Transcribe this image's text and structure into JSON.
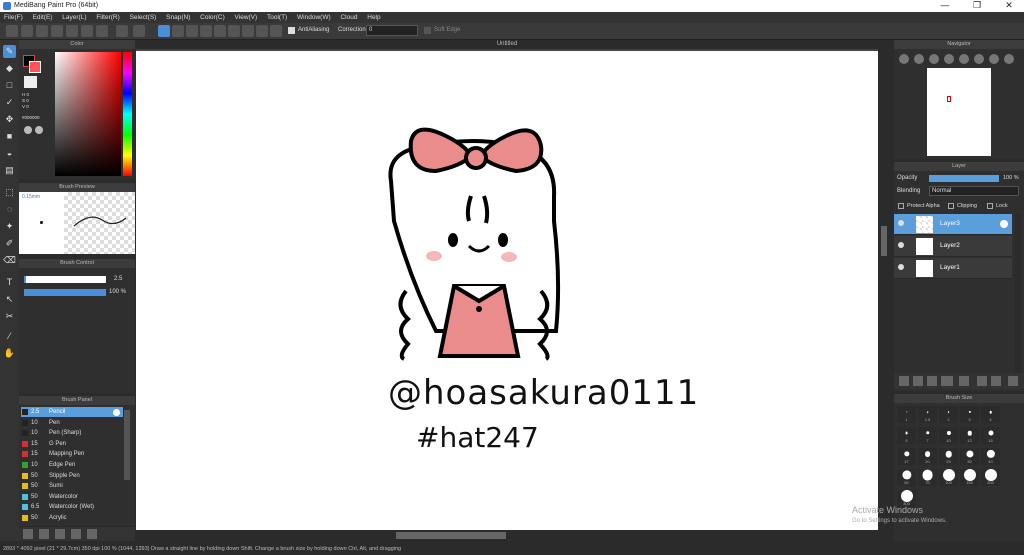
{
  "window": {
    "title": "MediBang Paint Pro (64bit)",
    "controls": [
      "—",
      "❐",
      "✕"
    ]
  },
  "menu": [
    "File(F)",
    "Edit(E)",
    "Layer(L)",
    "Filter(R)",
    "Select(S)",
    "Snap(N)",
    "Color(C)",
    "View(V)",
    "Tool(T)",
    "Window(W)",
    "Cloud",
    "Help"
  ],
  "toolbar": {
    "antialiasing": "AntiAliasing",
    "correction_label": "Correction",
    "correction_value": "0",
    "soft_edge": "Soft Edge"
  },
  "document": {
    "title": "Untitled"
  },
  "color_panel": {
    "title": "Color",
    "h": "H 0",
    "s": "S 0",
    "v": "V 0",
    "hex": "#000000"
  },
  "brush_preview": {
    "title": "Brush Preview",
    "size": "0.15mm"
  },
  "brush_control": {
    "title": "Brush Control",
    "size_value": "2.5",
    "opacity_value": "100 %",
    "opacity_fill": 1.0,
    "size_fill": 0.03
  },
  "brush_panel": {
    "title": "Brush Panel",
    "items": [
      {
        "num": "2.5",
        "name": "Pencil",
        "color": "#222222"
      },
      {
        "num": "10",
        "name": "Pen",
        "color": "#222222"
      },
      {
        "num": "10",
        "name": "Pen (Sharp)",
        "color": "#222222"
      },
      {
        "num": "15",
        "name": "G Pen",
        "color": "#d03030"
      },
      {
        "num": "15",
        "name": "Mapping Pen",
        "color": "#d03030"
      },
      {
        "num": "10",
        "name": "Edge Pen",
        "color": "#30a030"
      },
      {
        "num": "50",
        "name": "Stipple Pen",
        "color": "#e0c020"
      },
      {
        "num": "50",
        "name": "Sumi",
        "color": "#e0c020"
      },
      {
        "num": "50",
        "name": "Watercolor",
        "color": "#50c0e0"
      },
      {
        "num": "6.5",
        "name": "Watercolor (Wet)",
        "color": "#50c0e0"
      },
      {
        "num": "50",
        "name": "Acrylic",
        "color": "#e0c020"
      }
    ]
  },
  "navigator": {
    "title": "Navigator"
  },
  "layer_panel": {
    "title": "Layer",
    "opacity_label": "Opacity",
    "opacity_value": "100 %",
    "blending_label": "Blending",
    "blending_value": "Normal",
    "protect_alpha": "Protect Alpha",
    "clipping": "Clipping",
    "lock": "Lock",
    "layers": [
      "Layer3",
      "Layer2",
      "Layer1"
    ]
  },
  "brush_size": {
    "title": "Brush Size",
    "values": [
      "1",
      "1.5",
      "2",
      "3",
      "4",
      "5",
      "7",
      "10",
      "12",
      "15",
      "17",
      "20",
      "25",
      "30",
      "40",
      "50",
      "70",
      "100",
      "150",
      "200",
      "300"
    ]
  },
  "canvas_text": {
    "handle": "@hoasakura0111",
    "tag": "#hat247"
  },
  "watermark": {
    "line1": "Activate Windows",
    "line2": "Go to Settings to activate Windows."
  },
  "statusbar": {
    "text": "2893 * 4092 pixel   (21 * 29.7cm)   350 dpi   100 %   (1044, 1393)   Draw a straight line by holding down Shift. Change a brush size by holding down Ctrl, Alt, and dragging"
  }
}
